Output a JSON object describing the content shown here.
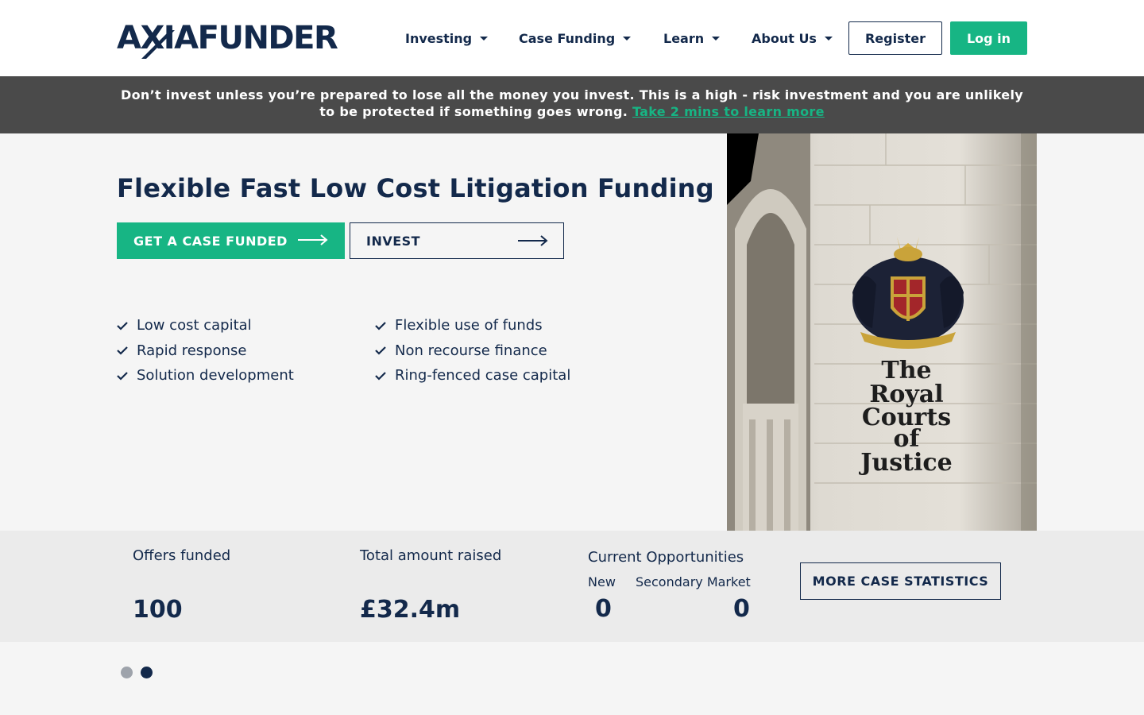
{
  "header": {
    "logo_text": "AXIAFUNDER",
    "nav": [
      {
        "label": "Investing"
      },
      {
        "label": "Case Funding"
      },
      {
        "label": "Learn"
      },
      {
        "label": "About Us"
      }
    ],
    "register_label": "Register",
    "login_label": "Log in"
  },
  "banner": {
    "text": "Don’t invest unless you’re prepared to lose all the money you invest. This is a high - risk investment and you are unlikely to be protected if something goes wrong.",
    "link_text": "Take 2 mins to learn more"
  },
  "hero": {
    "title": "Flexible Fast Low Cost Litigation Funding",
    "case_button": "GET A CASE FUNDED",
    "invest_button": "INVEST",
    "features_left": [
      "Low cost capital",
      "Rapid response",
      "Solution development"
    ],
    "features_right": [
      "Flexible use of funds",
      "Non recourse finance",
      "Ring-fenced case capital"
    ],
    "image_text": [
      "The",
      "Royal",
      "Courts",
      "of",
      "Justice"
    ]
  },
  "stats": {
    "offers_label": "Offers funded",
    "offers_value": "100",
    "raised_label": "Total amount raised",
    "raised_value": "£32.4m",
    "opportunities_label": "Current Opportunities",
    "new_label": "New",
    "new_value": "0",
    "secondary_label": "Secondary Market",
    "secondary_value": "0",
    "more_button": "MORE CASE STATISTICS"
  },
  "colors": {
    "navy": "#13294b",
    "green": "#17b584",
    "banner_bg": "#4a4a4a"
  }
}
